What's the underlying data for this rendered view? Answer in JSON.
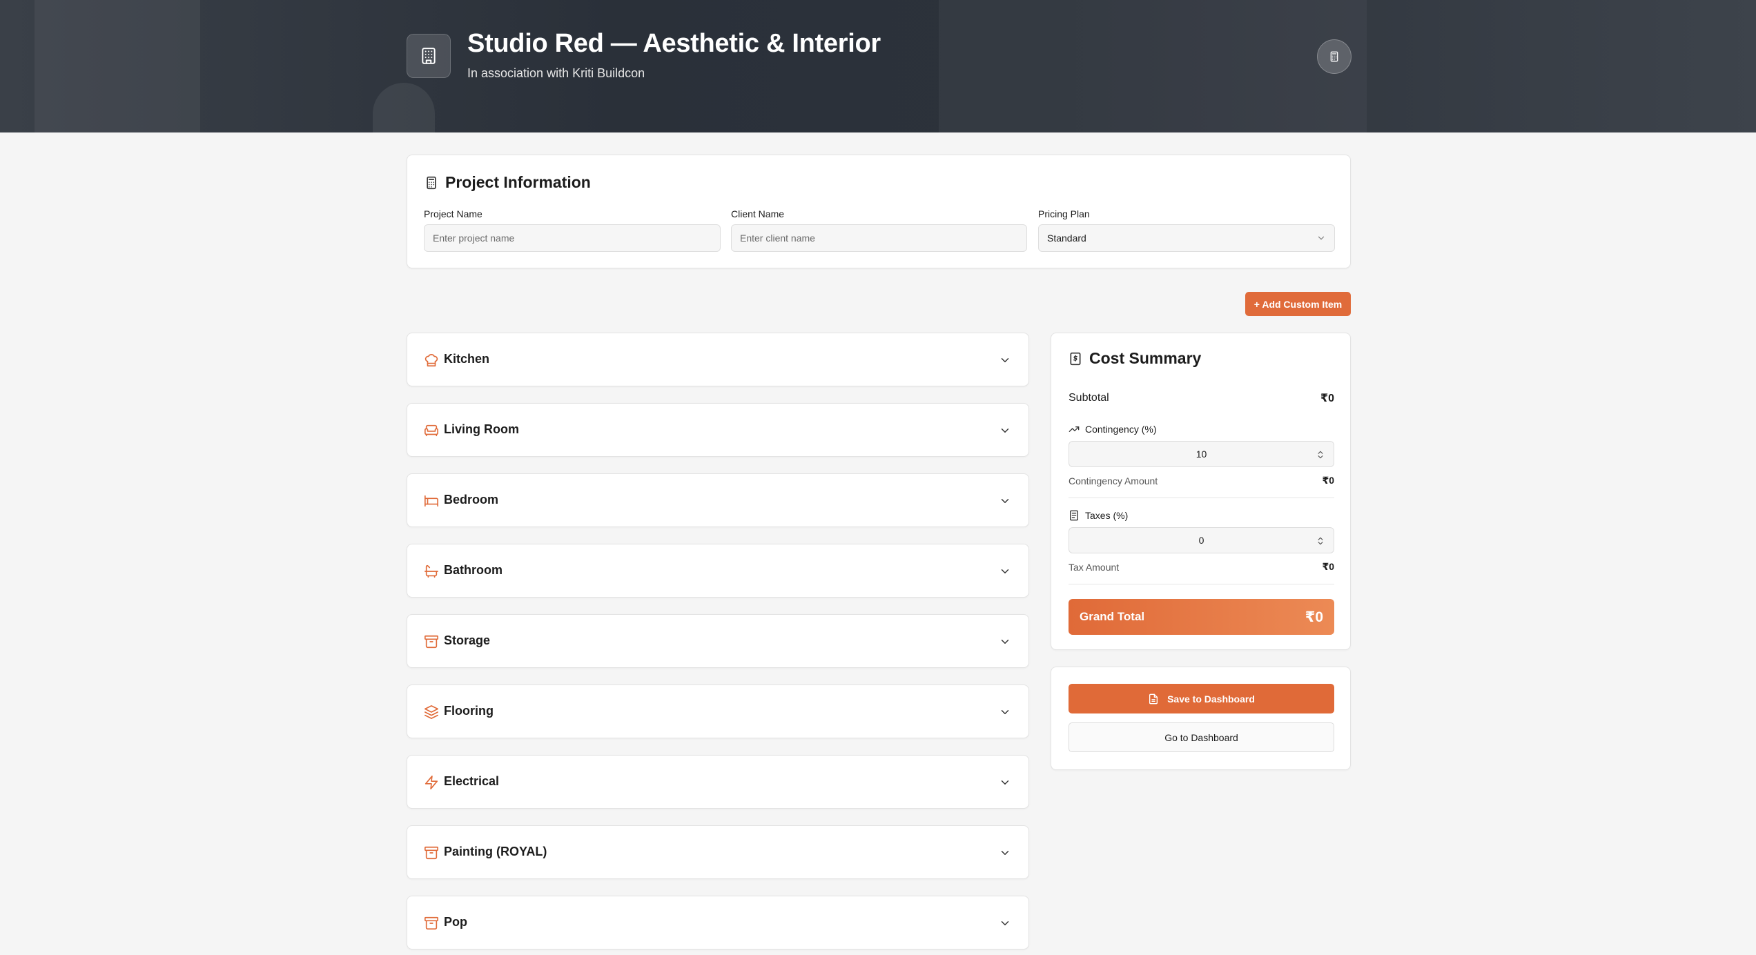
{
  "header": {
    "title": "Studio Red — Aesthetic & Interior",
    "subtitle": "In association with Kriti Buildcon",
    "logo_icon": "building-icon",
    "action_icon": "calculator-icon"
  },
  "project": {
    "title": "Project Information",
    "name_label": "Project Name",
    "name_placeholder": "Enter project name",
    "name_value": "",
    "client_label": "Client Name",
    "client_placeholder": "Enter client name",
    "client_value": "",
    "plan_label": "Pricing Plan",
    "plan_value": "Standard"
  },
  "add_custom_label": "+ Add Custom Item",
  "rooms": [
    {
      "label": "Kitchen",
      "icon": "chef-hat-icon"
    },
    {
      "label": "Living Room",
      "icon": "sofa-icon"
    },
    {
      "label": "Bedroom",
      "icon": "bed-icon"
    },
    {
      "label": "Bathroom",
      "icon": "bath-icon"
    },
    {
      "label": "Storage",
      "icon": "archive-icon"
    },
    {
      "label": "Flooring",
      "icon": "layers-icon"
    },
    {
      "label": "Electrical",
      "icon": "zap-icon"
    },
    {
      "label": "Painting (ROYAL)",
      "icon": "archive-icon"
    },
    {
      "label": "Pop",
      "icon": "archive-icon"
    }
  ],
  "summary": {
    "title": "Cost Summary",
    "subtotal_label": "Subtotal",
    "subtotal_value": "₹0",
    "contingency_label": "Contingency (%)",
    "contingency_value": "10",
    "contingency_amount_label": "Contingency Amount",
    "contingency_amount_value": "₹0",
    "taxes_label": "Taxes (%)",
    "taxes_value": "0",
    "tax_amount_label": "Tax Amount",
    "tax_amount_value": "₹0",
    "grand_total_label": "Grand Total",
    "grand_total_value": "₹0"
  },
  "actions": {
    "save_label": "Save to Dashboard",
    "dashboard_label": "Go to Dashboard"
  },
  "colors": {
    "accent": "#e06a38",
    "header_bg": "#2c323b"
  }
}
